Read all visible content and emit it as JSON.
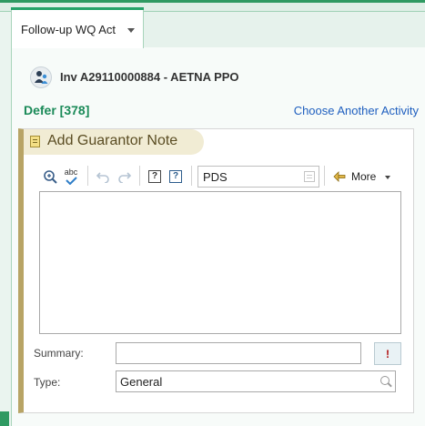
{
  "tab": {
    "label": "Follow-up WQ Act"
  },
  "invoice": {
    "title": "Inv A29110000884 - AETNA PPO"
  },
  "defer": {
    "label": "Defer [378]"
  },
  "choose_activity": {
    "label": "Choose Another Activity"
  },
  "panel": {
    "title": "Add Guarantor Note",
    "toolbar": {
      "zoom_icon": "magnifier-icon",
      "spellcheck_icon": "abc-check-icon",
      "spellcheck_text": "abc",
      "undo_icon": "undo-icon",
      "redo_icon": "redo-icon",
      "help1_icon": "question-box-icon",
      "help2_icon": "question-list-icon",
      "smarttext_value": "PDS",
      "insert_icon": "arrow-left-icon",
      "more_label": "More"
    },
    "summary": {
      "label": "Summary:",
      "value": "",
      "flag_glyph": "!"
    },
    "type": {
      "label": "Type:",
      "value": "General"
    }
  },
  "colors": {
    "accent": "#27a36a",
    "link": "#1f5fbf",
    "defer": "#1a8a58",
    "panel_border": "#b8a465"
  }
}
